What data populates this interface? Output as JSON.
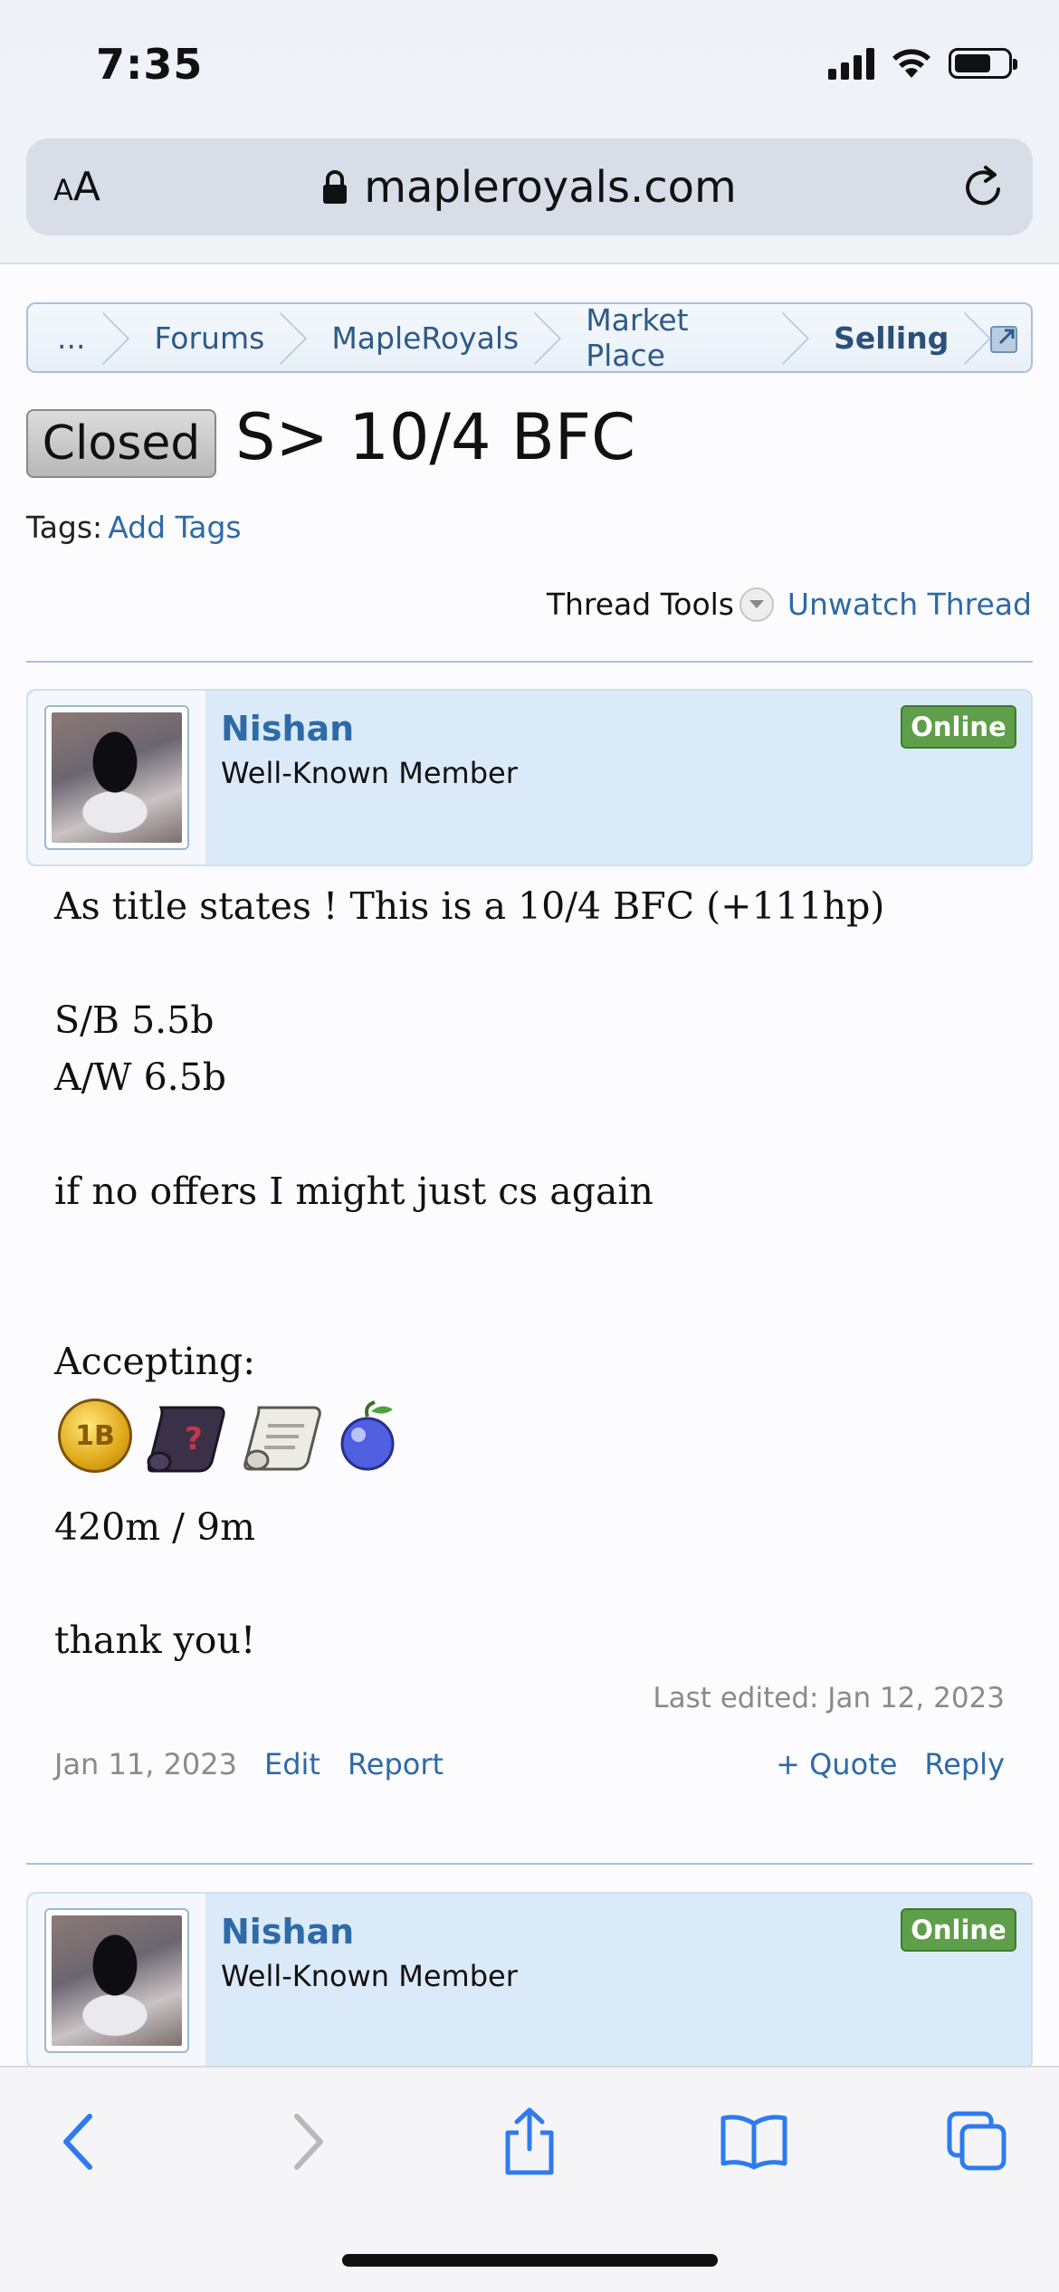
{
  "status_bar": {
    "time": "7:35"
  },
  "browser": {
    "text_size_label": "AA",
    "url": "mapleroyals.com"
  },
  "breadcrumb": {
    "items": [
      "...",
      "Forums",
      "MapleRoyals",
      "Market Place",
      "Selling"
    ]
  },
  "thread": {
    "prefix": "Closed",
    "title": "S> 10/4 BFC",
    "tags_label": "Tags:",
    "add_tags": "Add Tags",
    "thread_tools": "Thread Tools",
    "unwatch": "Unwatch Thread"
  },
  "post1": {
    "username": "Nishan",
    "user_title": "Well-Known Member",
    "status": "Online",
    "body": {
      "line1": "As title states ! This is a 10/4 BFC (+111hp)",
      "line2": "S/B 5.5b",
      "line3": "A/W 6.5b",
      "line4": "if no offers I might just cs again",
      "line5": "Accepting:",
      "line6": "420m / 9m",
      "line7": "thank you!"
    },
    "accepting_icons": [
      "1b-coin-icon",
      "chaos-scroll-icon",
      "white-scroll-icon",
      "onyx-apple-icon"
    ],
    "coin_text": "1B",
    "last_edited": "Last edited: Jan 12, 2023",
    "date": "Jan 11, 2023",
    "edit": "Edit",
    "report": "Report",
    "quote": "+ Quote",
    "reply": "Reply"
  },
  "post2": {
    "username": "Nishan",
    "user_title": "Well-Known Member",
    "status": "Online"
  },
  "colors": {
    "link": "#2e6aa7",
    "online_badge": "#5f9e4a",
    "post_header_bg": "#dbeaf8"
  }
}
